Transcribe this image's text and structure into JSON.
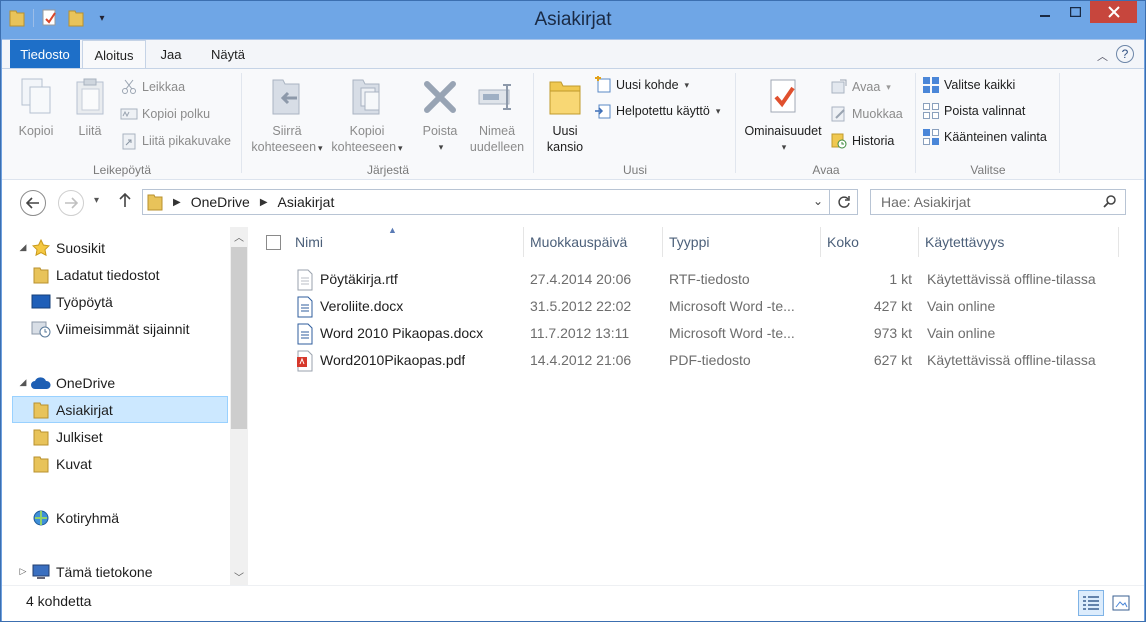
{
  "window": {
    "title": "Asiakirjat"
  },
  "ribbon_tabs": {
    "file": "Tiedosto",
    "home": "Aloitus",
    "share": "Jaa",
    "view": "Näytä"
  },
  "clipboard": {
    "label": "Leikepöytä",
    "copy": "Kopioi",
    "paste": "Liitä",
    "cut": "Leikkaa",
    "copy_path": "Kopioi polku",
    "paste_shortcut": "Liitä pikakuvake"
  },
  "organize": {
    "label": "Järjestä",
    "move_to_1": "Siirrä",
    "move_to_2": "kohteeseen",
    "copy_to_1": "Kopioi",
    "copy_to_2": "kohteeseen",
    "delete": "Poista",
    "rename_1": "Nimeä",
    "rename_2": "uudelleen"
  },
  "new": {
    "label": "Uusi",
    "new_folder_1": "Uusi",
    "new_folder_2": "kansio",
    "new_item": "Uusi kohde",
    "easy_access": "Helpotettu käyttö"
  },
  "open": {
    "label": "Avaa",
    "properties": "Ominaisuudet",
    "open": "Avaa",
    "edit": "Muokkaa",
    "history": "Historia"
  },
  "select": {
    "label": "Valitse",
    "select_all": "Valitse kaikki",
    "select_none": "Poista valinnat",
    "invert": "Käänteinen valinta"
  },
  "address": {
    "crumbs": [
      "OneDrive",
      "Asiakirjat"
    ],
    "search_placeholder": "Hae: Asiakirjat"
  },
  "nav": {
    "favorites": "Suosikit",
    "downloads": "Ladatut tiedostot",
    "desktop": "Työpöytä",
    "recent": "Viimeisimmät sijainnit",
    "onedrive": "OneDrive",
    "documents": "Asiakirjat",
    "public": "Julkiset",
    "pictures": "Kuvat",
    "homegroup": "Kotiryhmä",
    "this_pc": "Tämä tietokone"
  },
  "columns": {
    "name": "Nimi",
    "modified": "Muokkauspäivä",
    "type": "Tyyppi",
    "size": "Koko",
    "availability": "Käytettävyys"
  },
  "files": [
    {
      "name": "Pöytäkirja.rtf",
      "modified": "27.4.2014 20:06",
      "type": "RTF-tiedosto",
      "size": "1 kt",
      "availability": "Käytettävissä offline-tilassa",
      "icon": "rtf-file-icon"
    },
    {
      "name": "Veroliite.docx",
      "modified": "31.5.2012 22:02",
      "type": "Microsoft Word -te...",
      "size": "427 kt",
      "availability": "Vain online",
      "icon": "word-file-icon"
    },
    {
      "name": "Word 2010 Pikaopas.docx",
      "modified": "11.7.2012 13:11",
      "type": "Microsoft Word -te...",
      "size": "973 kt",
      "availability": "Vain online",
      "icon": "word-file-icon"
    },
    {
      "name": "Word2010Pikaopas.pdf",
      "modified": "14.4.2012 21:06",
      "type": "PDF-tiedosto",
      "size": "627 kt",
      "availability": "Käytettävissä offline-tilassa",
      "icon": "pdf-file-icon"
    }
  ],
  "status": {
    "count": "4 kohdetta"
  },
  "colors": {
    "accent": "#1e6fc8",
    "titlebar": "#6fa6e6",
    "close": "#c7463d",
    "selection": "#cce8ff"
  }
}
